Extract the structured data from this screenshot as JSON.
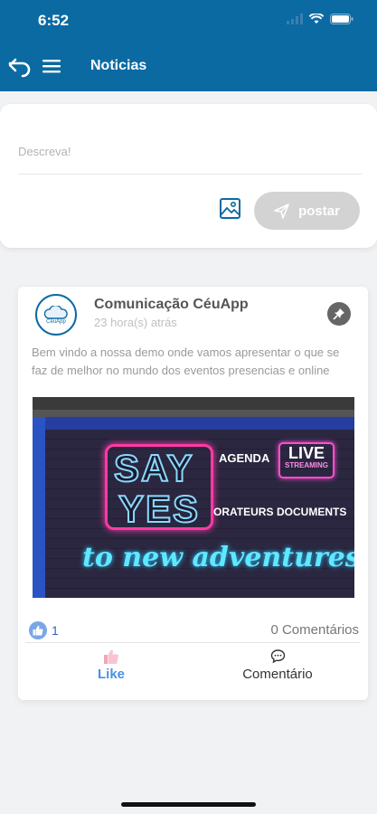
{
  "status_bar": {
    "time": "6:52"
  },
  "header": {
    "title": "Noticias"
  },
  "composer": {
    "placeholder": "Descreva!",
    "post_label": "postar"
  },
  "post": {
    "author": "Comunicação CéuApp",
    "avatar_text": "CéuApp",
    "time": "23 hora(s) atrás",
    "text": "Bem vindo a nossa demo onde vamos apresentar o que se faz de melhor no mundo dos eventos presencias e online",
    "image": {
      "say": "SAY",
      "yes": "YES",
      "agenda": "AGENDA",
      "live": "LIVE",
      "streaming": "STREAMING",
      "orateurs": "ORATEURS",
      "documents": "DOCUMENTS",
      "adventures": "to new adventures!"
    },
    "likes": "1",
    "comments": "0 Comentários",
    "like_label": "Like",
    "comment_label": "Comentário"
  },
  "colors": {
    "primary": "#0b6aa2",
    "like": "#4a90e2",
    "post_button": "#d3d3d3"
  }
}
